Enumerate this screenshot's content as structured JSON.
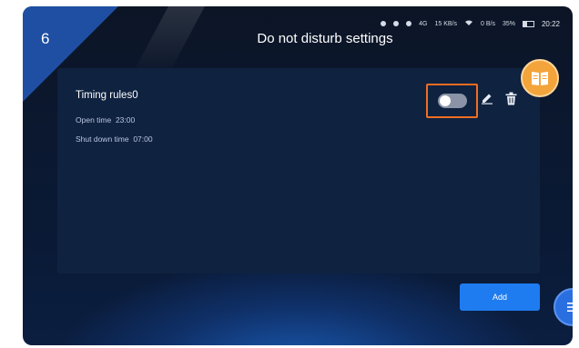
{
  "step": {
    "number": "6"
  },
  "header": {
    "title": "Do not disturb settings"
  },
  "status_bar": {
    "signal": "4G",
    "net_speed_1": "15 KB/s",
    "wifi_speed": "0 B/s",
    "battery": "35%",
    "time": "20:22"
  },
  "rule": {
    "title": "Timing rules0",
    "open_label": "Open time",
    "open_value": "23:00",
    "shut_label": "Shut down time",
    "shut_value": "07:00",
    "enabled": false
  },
  "buttons": {
    "add_label": "Add"
  },
  "colors": {
    "highlight": "#f26d21",
    "accent": "#1f7cf0",
    "card": "#0f2240",
    "fab_orange": "#f3a43a"
  },
  "icons": [
    "edit-icon",
    "trash-icon",
    "book-icon",
    "menu-icon",
    "bell-icon",
    "alarm-icon",
    "wifi-icon",
    "battery-icon"
  ]
}
